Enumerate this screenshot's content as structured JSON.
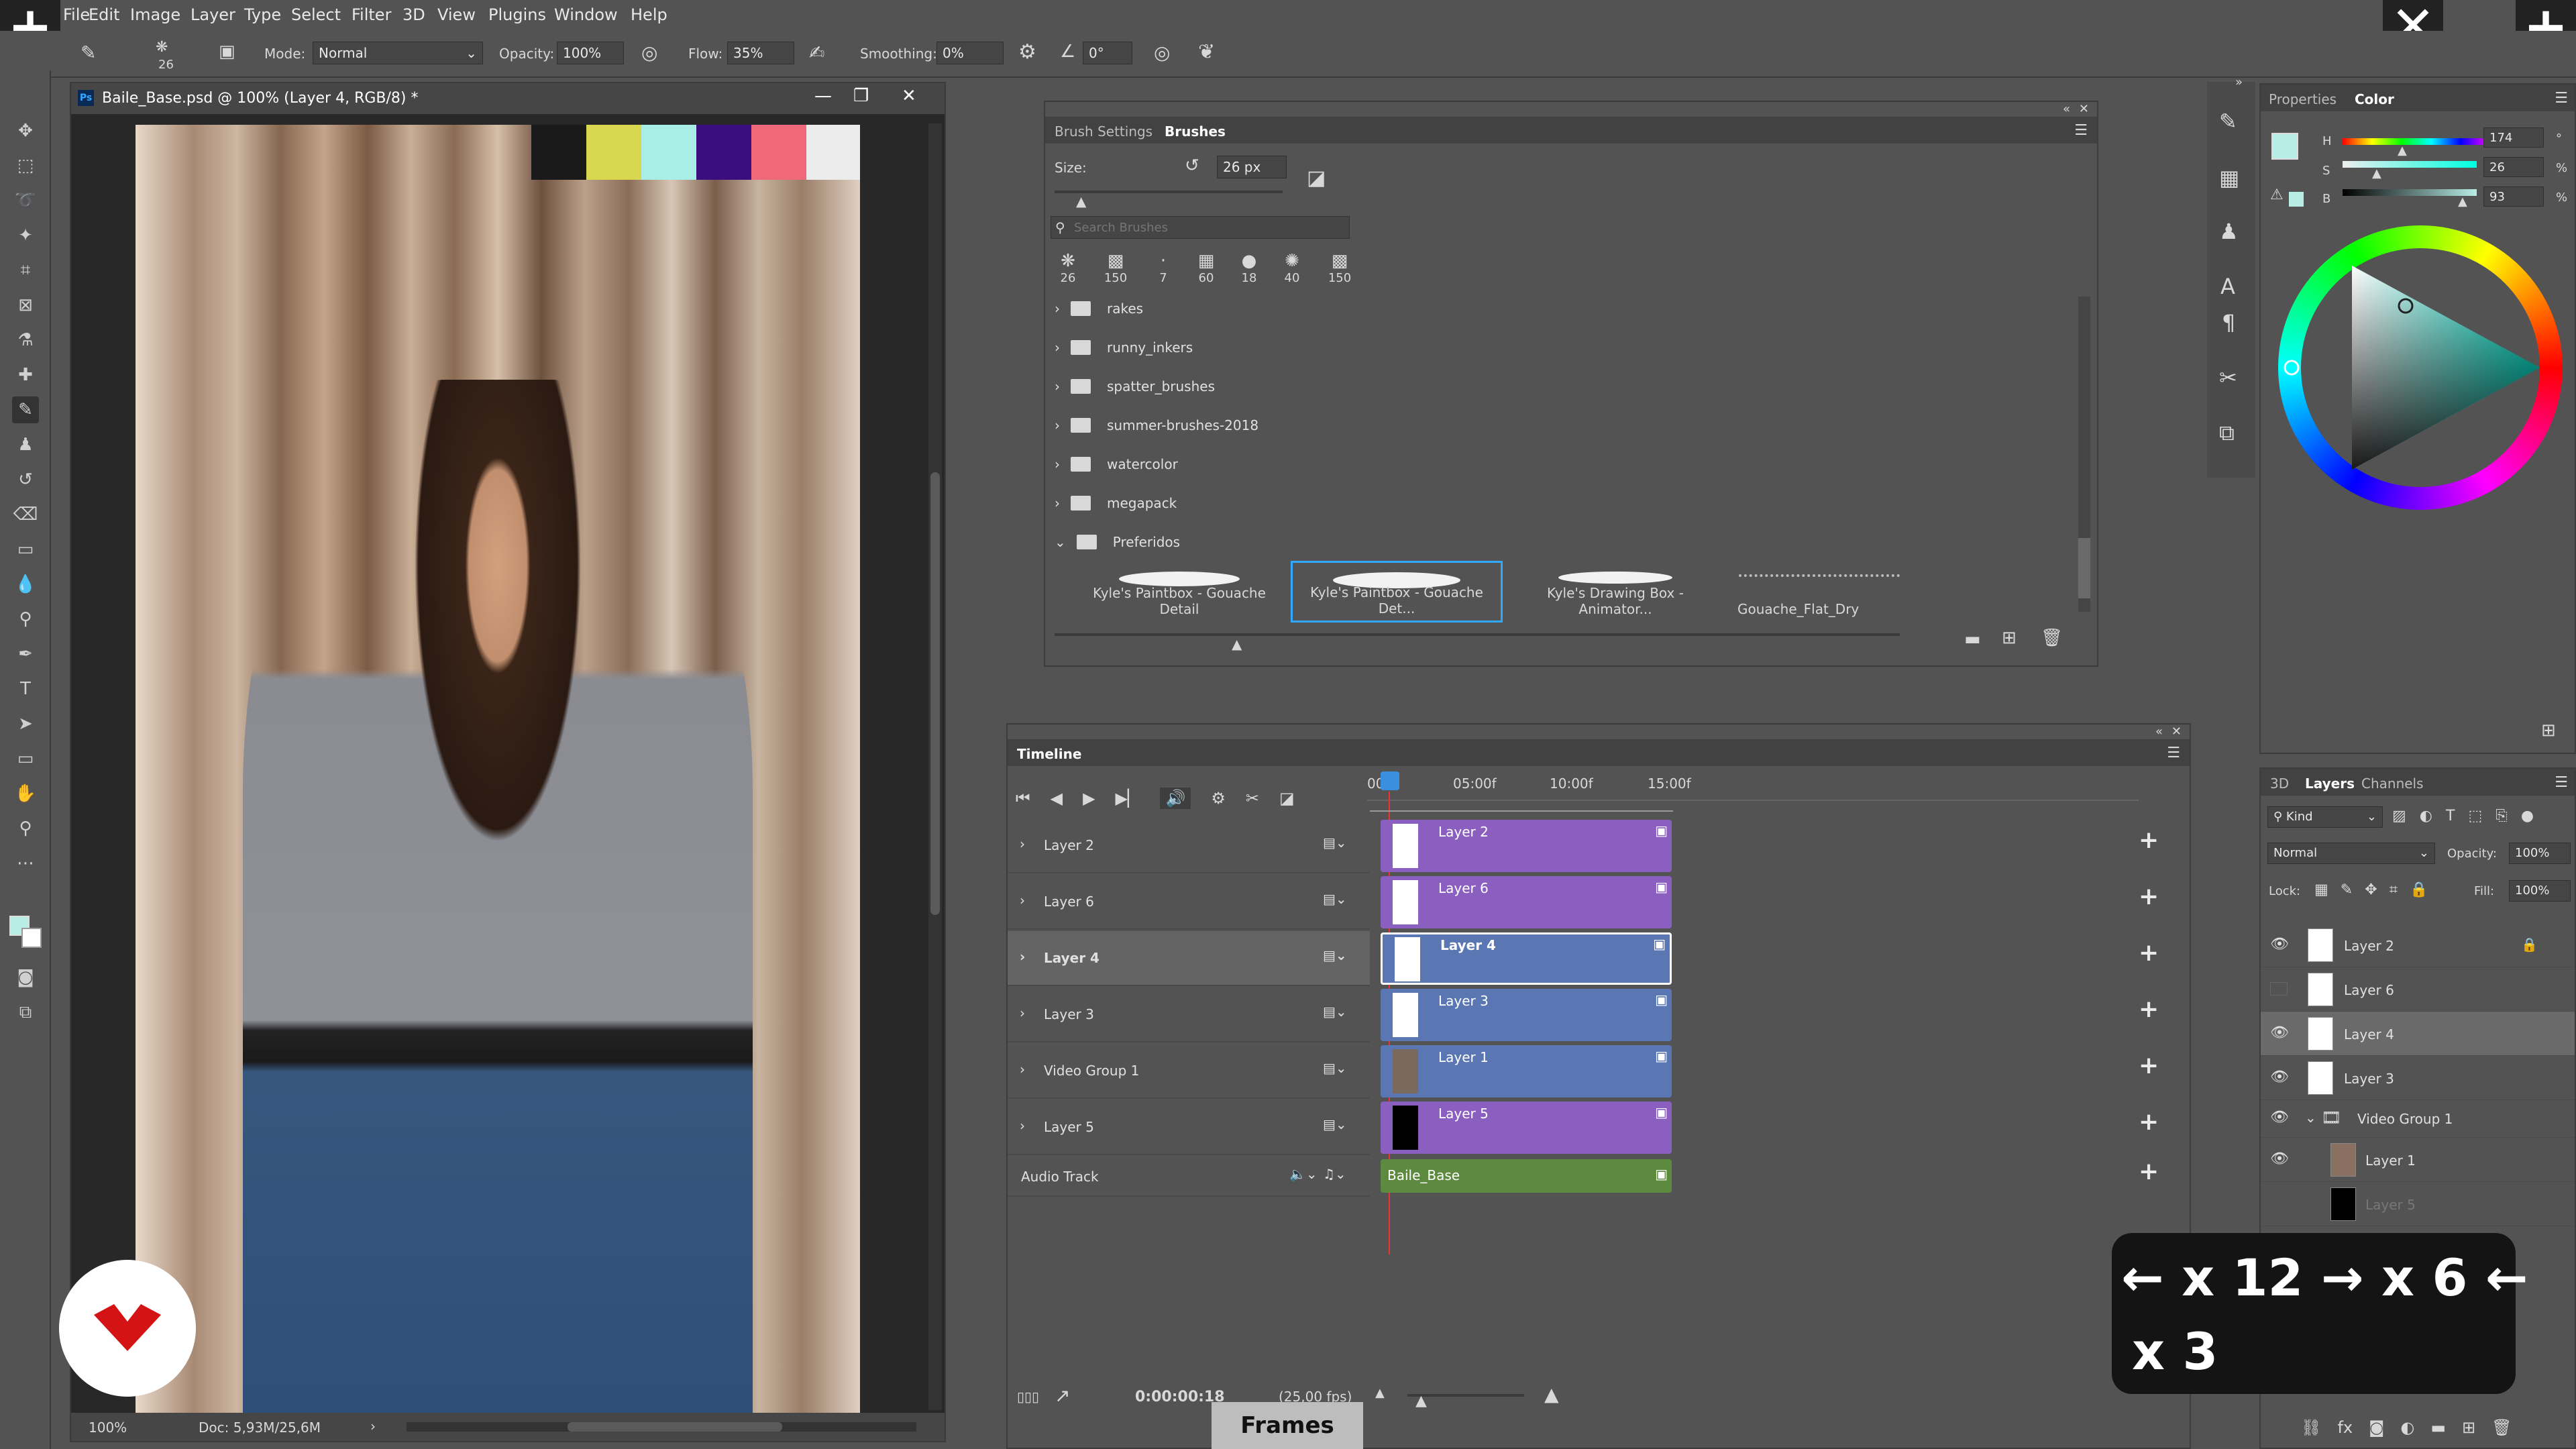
{
  "menu": [
    "File",
    "Edit",
    "Image",
    "Layer",
    "Type",
    "Select",
    "Filter",
    "3D",
    "View",
    "Plugins",
    "Window",
    "Help"
  ],
  "options": {
    "brush_size": "26",
    "mode_label": "Mode:",
    "mode_value": "Normal",
    "opacity_label": "Opacity:",
    "opacity_value": "100%",
    "flow_label": "Flow:",
    "flow_value": "35%",
    "smoothing_label": "Smoothing:",
    "smoothing_value": "0%",
    "angle_value": "0°"
  },
  "document": {
    "title": "Baile_Base.psd @ 100% (Layer 4, RGB/8) *",
    "zoom": "100%",
    "doc_info": "Doc: 5,93M/25,6M",
    "swatches": [
      "#1a1a1a",
      "#d9d650",
      "#a8ede6",
      "#3a0e7e",
      "#f0697a",
      "#ececec"
    ]
  },
  "brushes_panel": {
    "tabs": [
      "Brush Settings",
      "Brushes"
    ],
    "size_label": "Size:",
    "size_value": "26 px",
    "search_placeholder": "Search Brushes",
    "recent_sizes": [
      "26",
      "150",
      "7",
      "60",
      "18",
      "40",
      "150"
    ],
    "folders": [
      "rakes",
      "runny_inkers",
      "spatter_brushes",
      "summer-brushes-2018",
      "watercolor",
      "megapack",
      "Preferidos"
    ],
    "presets": [
      "Kyle's Paintbox - Gouache Detail",
      "Kyle's Paintbox - Gouache Det...",
      "Kyle's Drawing Box - Animator...",
      "Gouache_Flat_Dry"
    ]
  },
  "timeline": {
    "title": "Timeline",
    "ruler": [
      "00",
      "05:00f",
      "10:00f",
      "15:00f"
    ],
    "tracks": [
      {
        "name": "Layer 2",
        "clip": "Layer 2",
        "color": "#8b5fbf"
      },
      {
        "name": "Layer 6",
        "clip": "Layer 6",
        "color": "#8b5fbf"
      },
      {
        "name": "Layer 4",
        "clip": "Layer 4",
        "color": "#5a77b3"
      },
      {
        "name": "Layer 3",
        "clip": "Layer 3",
        "color": "#5a77b3"
      },
      {
        "name": "Video Group 1",
        "clip": "Layer 1",
        "color": "#5a77b3"
      },
      {
        "name": "Layer 5",
        "clip": "Layer 5",
        "color": "#8b5fbf"
      }
    ],
    "audio_track": "Audio Track",
    "audio_clip": "Baile_Base",
    "time": "0:00:00:18",
    "fps": "(25,00 fps)"
  },
  "color_panel": {
    "tabs": [
      "Properties",
      "Color"
    ],
    "h_label": "H",
    "h_value": "174",
    "h_unit": "°",
    "s_label": "S",
    "s_value": "26",
    "s_unit": "%",
    "b_label": "B",
    "b_value": "93",
    "b_unit": "%",
    "foreground": "#b8ede6"
  },
  "layers_panel": {
    "tabs": [
      "3D",
      "Layers",
      "Channels"
    ],
    "kind": "Kind",
    "blend": "Normal",
    "opacity_label": "Opacity:",
    "opacity_value": "100%",
    "lock_label": "Lock:",
    "fill_label": "Fill:",
    "fill_value": "100%",
    "layers": [
      "Layer 2",
      "Layer 6",
      "Layer 4",
      "Layer 3",
      "Video Group 1",
      "Layer 1",
      "Layer 5"
    ]
  },
  "overlay": {
    "line1": "← x 12 → x 6 ←",
    "line2": "x 3"
  },
  "frames_label": "Frames"
}
